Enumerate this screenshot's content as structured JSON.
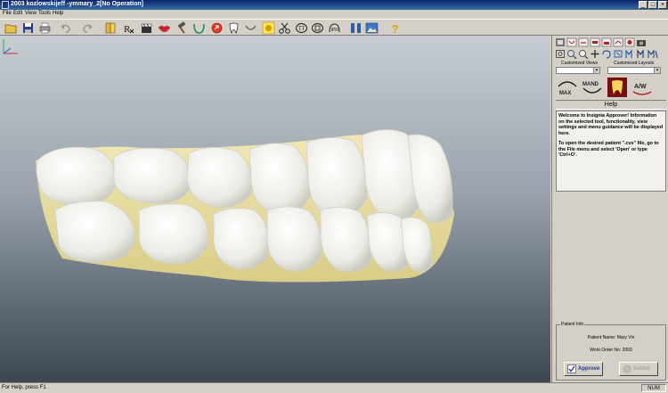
{
  "window": {
    "title": "2003 kozlowskijeff -ymmary_2[No Operation]",
    "controls": [
      "_",
      "□",
      "×"
    ]
  },
  "menu": [
    "File",
    "Edit",
    "View",
    "Tools",
    "Help"
  ],
  "toolbar": {
    "icons": [
      "open-folder-icon",
      "save-icon",
      "print-icon",
      "undo-icon",
      "redo-icon",
      "book-icon",
      "prescription-icon",
      "clapper-icon",
      "lips-icon",
      "hammer-icon",
      "arch-curve-icon",
      "circle-arrow-icon",
      "tooth-outline-icon",
      "smile-curve-icon",
      "highlight-icon",
      "scissors-icon",
      "arch-teeth-icon",
      "gap-icon",
      "ipr-icon",
      "split-view-icon",
      "image-view-icon",
      "help-icon"
    ],
    "rx_glyph": "R"
  },
  "right_panel": {
    "customized_views_label": "Customized Views",
    "customized_layouts_label": "Customized Layouts",
    "view_buttons": [
      {
        "label": "MAX"
      },
      {
        "label": "MAND"
      },
      {
        "label": ""
      },
      {
        "label": "A/W"
      }
    ],
    "help_title": "Help",
    "help_paragraphs": [
      "Welcome to Insignia Approver! Information on the selected tool, functionality, view settings and menu guidance will be displayed here.",
      "To open the desired patient \".cvs\" file, go to the File menu and select 'Open' or type 'Ctrl+O'."
    ],
    "patient_info": {
      "legend": "Patient Info",
      "name_line": "Patient Name: Mary Vin",
      "work_order_line": "Work Order No: 2003",
      "approve_label": "Approve",
      "submit_label": "Submit"
    }
  },
  "status": {
    "text": "For Help, press F1",
    "num": "NUM"
  },
  "colors": {
    "title_bar": "#0a246a",
    "viewport_top": "#c6ccd2",
    "viewport_bottom": "#3d4752",
    "tooth_enamel": "#efefea",
    "gingiva": "#eadfa6"
  }
}
